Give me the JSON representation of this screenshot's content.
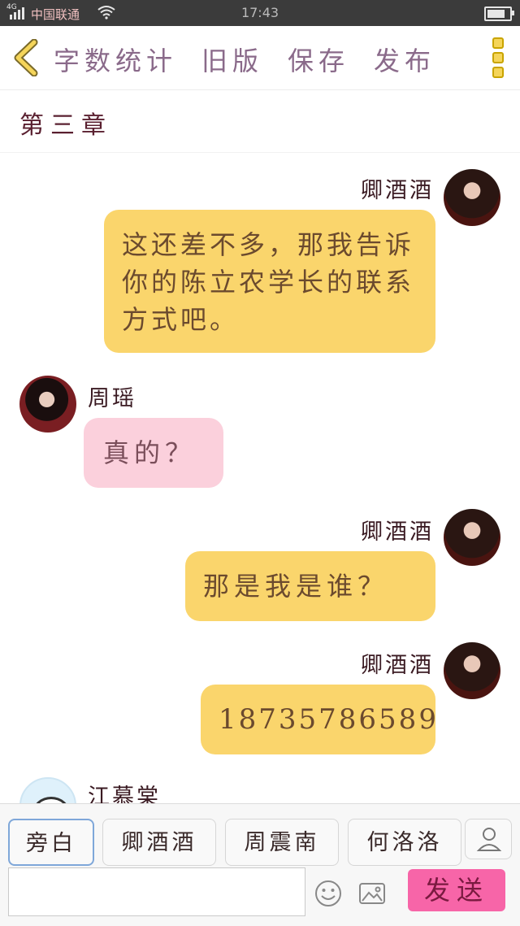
{
  "status_bar": {
    "network": "4G",
    "carrier": "中国联通",
    "time": "17:43"
  },
  "nav": {
    "word_count": "字数统计",
    "old_version": "旧版",
    "save": "保存",
    "publish": "发布"
  },
  "chapter": {
    "title": "第三章"
  },
  "messages": [
    {
      "side": "right",
      "name": "卿酒酒",
      "text": "这还差不多，那我告诉你的陈立农学长的联系方式吧。"
    },
    {
      "side": "left",
      "name": "周瑶",
      "text": "真的？"
    },
    {
      "side": "right",
      "name": "卿酒酒",
      "text": "那是我是谁？"
    },
    {
      "side": "right",
      "name": "卿酒酒",
      "text": "18735786589"
    },
    {
      "side": "left",
      "name": "江慕棠",
      "text": ""
    }
  ],
  "composer": {
    "roles": [
      "旁白",
      "卿酒酒",
      "周震南",
      "何洛洛"
    ],
    "active_role": "旁白",
    "input_value": "",
    "send_label": "发送"
  },
  "colors": {
    "yellow_bubble": "#fad56c",
    "pink_bubble": "#fbd0dc",
    "send_button": "#f765a8",
    "active_role_border": "#7fa7d9"
  }
}
